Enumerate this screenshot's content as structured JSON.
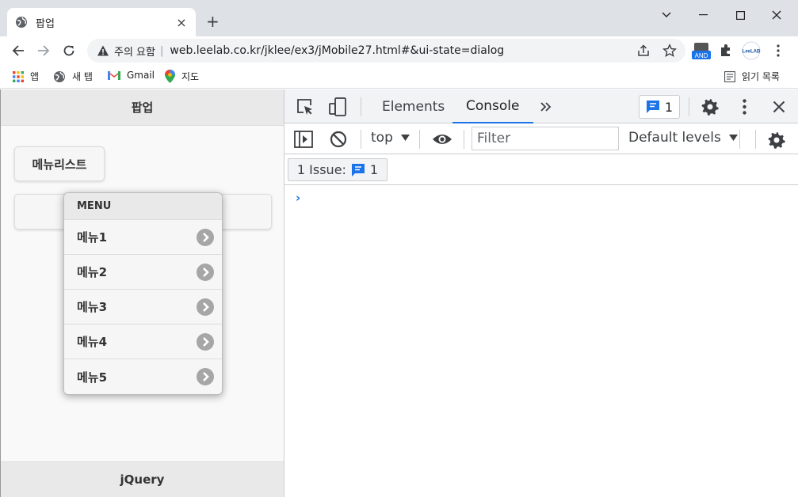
{
  "browser": {
    "tab_title": "팝업",
    "new_tab": "+",
    "tab_close": "×",
    "security_text": "주의 요함",
    "separator": "|",
    "url": "web.leelab.co.kr/jklee/ex3/jMobile27.html#&ui-state=dialog",
    "ext_badge": "AND",
    "ext_leelab": "LeeLAB"
  },
  "bookmarks": {
    "apps": "앱",
    "new_tab": "새 탭",
    "gmail": "Gmail",
    "maps": "지도",
    "reading_list": "읽기 목록"
  },
  "page": {
    "header_title": "팝업",
    "menu_button_label": "메뉴리스트",
    "footer_title": "jQuery",
    "popup": {
      "header": "MENU",
      "items": [
        "메뉴1",
        "메뉴2",
        "메뉴3",
        "메뉴4",
        "메뉴5"
      ]
    }
  },
  "devtools": {
    "tabs": {
      "elements": "Elements",
      "console": "Console"
    },
    "issues_count": "1",
    "context": "top",
    "filter_placeholder": "Filter",
    "levels": "Default levels",
    "issue_chip_label": "1 Issue:",
    "issue_chip_count": "1",
    "prompt": "›"
  },
  "colors": {
    "accent": "#1a73e8",
    "chrome_frame": "#dee1e6"
  }
}
